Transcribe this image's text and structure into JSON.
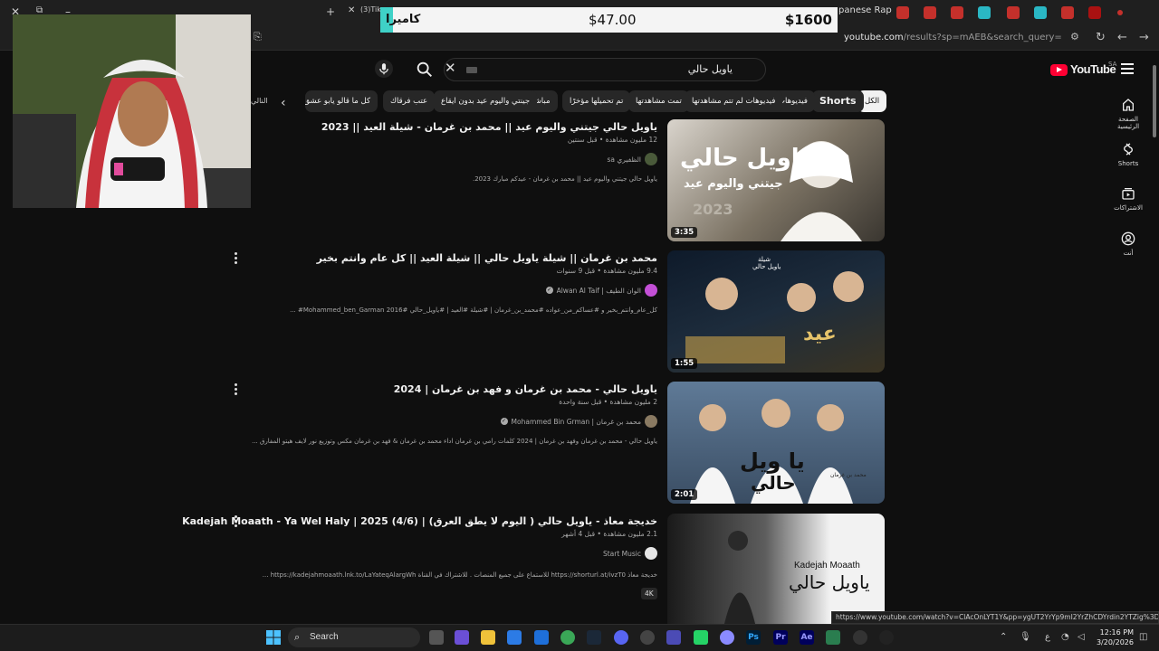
{
  "browser": {
    "tab_left_label": "(3)Tik",
    "tab_right_label": "panese Rap [Full",
    "url_host": "youtube.com",
    "url_path": "/results?sp=mAEB&search_query=يا+ويل+حالي"
  },
  "overlay": {
    "label": "كاميرا",
    "mid_value": "$47.00",
    "right_value": "$1600"
  },
  "youtube": {
    "logo_text": "YouTube",
    "country_code": "SA",
    "search_value": "ياويل حالي",
    "chips": [
      "الكل",
      "Shorts",
      "فيديوهات",
      "فيديوهات لم تتم مشاهدتها",
      "تمت مشاهدتها",
      "تم تحميلها مؤخرًا",
      "مباشر",
      "جينتي واليوم عيد بدون ايقاع",
      "عتب فرقاك",
      "كل ما قالو يابو عشق تحـ"
    ],
    "chips_cut": "النالي",
    "sidebar": [
      {
        "label": "الصفحة الرئيسية",
        "icon": "home-icon"
      },
      {
        "label": "Shorts",
        "icon": "shorts-icon"
      },
      {
        "label": "الاشتراكات",
        "icon": "subscriptions-icon"
      },
      {
        "label": "أنت",
        "icon": "you-icon"
      }
    ],
    "results": [
      {
        "title": "ياويل حالي جيتني واليوم عيد || محمد بن غرمان - شيلة العيد || 2023",
        "meta": "12 مليون مشاهدة • قبل سنتين",
        "channel": "الظفيري sa",
        "desc": "ياويل حالي جيتني واليوم عيد || محمد بن غرمان - عيدكم مبارك 2023.",
        "duration": "3:35",
        "thumb_line1": "ياويل حالي",
        "thumb_line2": "جيتني واليوم عيد",
        "thumb_line3": "2023"
      },
      {
        "title": "محمد بن غرمان || شيلة ياويل حالي || شيلة العيد || كل عام وانتم بخير",
        "meta": "9.4 مليون مشاهدة • قبل 9 سنوات",
        "channel": "الوان الطيف | Alwan Al Taif",
        "desc": "كل_عام_وانتم_بخير و #عساكم_من_عواده #محمد_بن_غرمان | #شيلة #العيد | #ياويل_حالي #2016 Mohammed_ben_Garman# ...",
        "duration": "1:55",
        "thumb_line1": "شيلة",
        "thumb_line2": "ياويل حالي",
        "thumb_line3": "عيد"
      },
      {
        "title": "ياويل حالي - محمد بن غرمان و فهد بن غرمان | 2024",
        "meta": "2 مليون مشاهدة • قبل سنة واحدة",
        "channel": "محمد بن غرمان | Mohammed Bin Grman",
        "desc": "ياويل حالي - محمد بن غرمان وفهد بن غرمان | 2024 كلمات رامي بن غرمان اداء محمد بن غرمان & فهد بن غرمان مكس وتوزيع نور لايف هيتو المفارق ...",
        "duration": "2:01",
        "thumb_line1": "يا ويل",
        "thumb_line2": "حالي",
        "thumb_line3": "محمد بن غرمان"
      },
      {
        "title": "خديجة معاذ - ياويل حالي ( اليوم لا يطق العرق) | Kadejah Moaath - Ya Wel Haly | 2025 (4/6)",
        "meta": "2.1 مليون مشاهدة • قبل 4 أشهر",
        "channel": "Start Music",
        "desc": "خديجة معاذ https://shorturl.at/ivzT0 للاستماع على جميع المنصات . للاشتراك في القناة https://kadejahmoaath.lnk.to/LaYateqAlargWh ...",
        "badge": "4K",
        "thumb_line1": "Kadejah Moaath",
        "thumb_line2": "ياويل حالي",
        "thumb_line3": ""
      }
    ],
    "status_url": "https://www.youtube.com/watch?v=ClAcOnLYT1Y&pp=ygUT2YrYp9mI2YrZhCDYrdin2YTZig%3D%3D"
  },
  "taskbar": {
    "search_label": "Search",
    "time": "12:16 PM",
    "date": "3/20/2026",
    "lang": "ع"
  }
}
